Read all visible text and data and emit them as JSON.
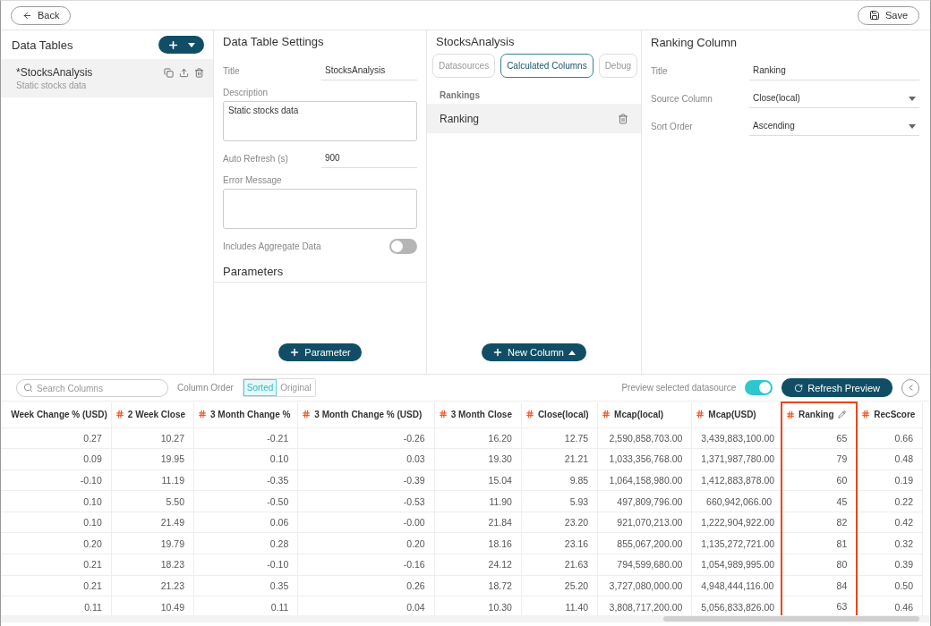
{
  "topbar": {
    "back": "Back",
    "save": "Save"
  },
  "data_tables": {
    "title": "Data Tables",
    "items": [
      {
        "name": "*StocksAnalysis",
        "description": "Static stocks data",
        "selected": true
      }
    ]
  },
  "settings": {
    "title": "Data Table Settings",
    "fields": [
      {
        "kind": "inline",
        "label": "Title",
        "value": "StocksAnalysis"
      },
      {
        "kind": "textarea",
        "label": "Description",
        "value": "Static stocks data"
      },
      {
        "kind": "inline",
        "label": "Auto Refresh (s)",
        "value": "900"
      },
      {
        "kind": "textarea",
        "label": "Error Message"
      },
      {
        "kind": "toggle",
        "label": "Includes Aggregate Data",
        "on": false
      }
    ],
    "parameters_title": "Parameters",
    "add_parameter": "Parameter"
  },
  "datasource": {
    "title": "StocksAnalysis",
    "tabs": [
      {
        "label": "Datasources",
        "selected": false
      },
      {
        "label": "Calculated Columns",
        "selected": true
      },
      {
        "label": "Debug",
        "selected": false
      }
    ],
    "group": "Rankings",
    "items": [
      {
        "name": "Ranking",
        "selected": true
      }
    ],
    "add_column": "New Column"
  },
  "ranking_column": {
    "title": "Ranking Column",
    "fields": [
      {
        "kind": "inline",
        "label": "Title",
        "value": "Ranking"
      },
      {
        "kind": "select",
        "label": "Source Column",
        "value": "Close(local)"
      },
      {
        "kind": "select",
        "label": "Sort Order",
        "value": "Ascending"
      }
    ]
  },
  "preview_toolbar": {
    "search": {
      "placeholder": "Search Columns"
    },
    "column_order_label": "Column Order",
    "column_order": [
      {
        "label": "Sorted",
        "selected": true
      },
      {
        "label": "Original",
        "selected": false
      }
    ],
    "preview_label": "Preview selected datasource",
    "preview_on": true,
    "refresh": "Refresh Preview"
  },
  "table": {
    "columns": [
      {
        "label": "Week Change % (USD)",
        "hash": false,
        "selected": false
      },
      {
        "label": "2 Week Close",
        "hash": true,
        "selected": false
      },
      {
        "label": "3 Month Change %",
        "hash": true,
        "selected": false
      },
      {
        "label": "3 Month Change % (USD)",
        "hash": true,
        "selected": false
      },
      {
        "label": "3 Month Close",
        "hash": true,
        "selected": false
      },
      {
        "label": "Close(local)",
        "hash": true,
        "selected": false
      },
      {
        "label": "Mcap(local)",
        "hash": true,
        "selected": false
      },
      {
        "label": "Mcap(USD)",
        "hash": true,
        "selected": false
      },
      {
        "label": "Ranking",
        "hash": true,
        "selected": true
      },
      {
        "label": "RecScore",
        "hash": true,
        "selected": false
      }
    ],
    "rows": [
      [
        "0.27",
        "10.27",
        "-0.21",
        "-0.26",
        "16.20",
        "12.75",
        "2,590,858,703.00",
        "3,439,883,100.00",
        "65",
        "0.66"
      ],
      [
        "0.09",
        "19.95",
        "0.10",
        "0.03",
        "19.30",
        "21.21",
        "1,033,356,768.00",
        "1,371,987,780.00",
        "79",
        "0.48"
      ],
      [
        "-0.10",
        "11.19",
        "-0.35",
        "-0.39",
        "15.04",
        "9.85",
        "1,064,158,980.00",
        "1,412,883,878.00",
        "60",
        "0.19"
      ],
      [
        "0.10",
        "5.50",
        "-0.50",
        "-0.53",
        "11.90",
        "5.93",
        "497,809,796.00",
        "660,942,066.00",
        "45",
        "0.22"
      ],
      [
        "0.10",
        "21.49",
        "0.06",
        "-0.00",
        "21.84",
        "23.20",
        "921,070,213.00",
        "1,222,904,922.00",
        "82",
        "0.42"
      ],
      [
        "0.20",
        "19.79",
        "0.28",
        "0.20",
        "18.16",
        "23.16",
        "855,067,200.00",
        "1,135,272,721.00",
        "81",
        "0.32"
      ],
      [
        "0.21",
        "18.23",
        "-0.10",
        "-0.16",
        "24.12",
        "21.63",
        "794,599,680.00",
        "1,054,989,995.00",
        "80",
        "0.39"
      ],
      [
        "0.21",
        "21.23",
        "0.35",
        "0.26",
        "18.72",
        "25.20",
        "3,727,080,000.00",
        "4,948,444,116.00",
        "84",
        "0.50"
      ],
      [
        "0.11",
        "10.49",
        "0.11",
        "0.04",
        "10.30",
        "11.40",
        "3,808,717,200.00",
        "5,056,833,826.00",
        "63",
        "0.46"
      ]
    ]
  }
}
